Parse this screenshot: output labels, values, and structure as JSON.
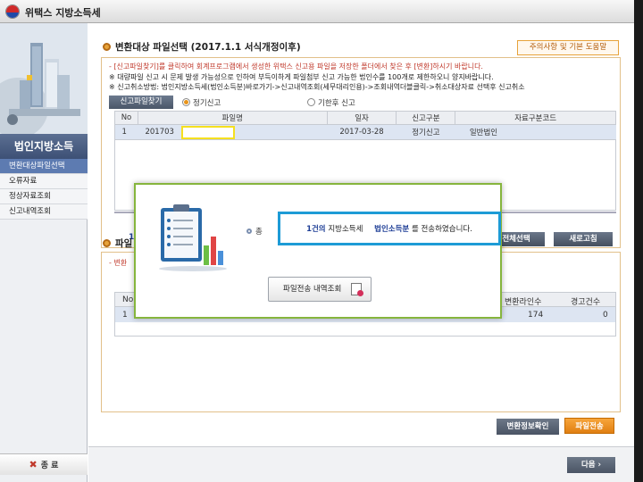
{
  "window": {
    "title": "위택스 지방소득세"
  },
  "sidebar": {
    "title": "법인지방소득",
    "items": [
      {
        "label": "변환대상파일선택",
        "active": true
      },
      {
        "label": "오류자료",
        "active": false
      },
      {
        "label": "정상자료조회",
        "active": false
      },
      {
        "label": "신고내역조회",
        "active": false
      }
    ],
    "exit_label": "종 료"
  },
  "section1": {
    "title": "변환대상 파일선택 (2017.1.1 서식개정이후)",
    "notice_button": "주의사항 및 기본 도움말",
    "info_lines": [
      "- [신고파일찾기]를 클릭하여 회계프로그램에서 생성한 위택스 신고용 파일을 저장한 폴더에서 찾은 후 [변환]하시기 바랍니다.",
      "※ 대량파일 신고 시 문제 발생 가능성으로 인하여 부득이하게 파일첨부 신고 가능한 법인수를 100개로 제한하오니 양지바랍니다.",
      "※ 신고취소방법: 법인지방소득세(법인소득분)바로가기->신고내역조회(세무대리인용)->조회내역더블클릭->취소대상자료 선택후 신고취소"
    ],
    "find_button": "신고파일찾기",
    "radio_regular": "정기신고",
    "radio_late": "기한후 신고",
    "table": {
      "headers": [
        "No",
        "파일명",
        "일자",
        "신고구분",
        "자료구분코드"
      ],
      "rows": [
        {
          "no": "1",
          "file": "201703",
          "date": "2017-03-28",
          "type": "정기신고",
          "code": "일반법인"
        }
      ]
    },
    "partial_number": "1",
    "select_all_button": "전체선택",
    "refresh_button": "새로고침"
  },
  "section2": {
    "title_partial": "파일",
    "info_partial": "- 변환",
    "headers_partial": [
      "No",
      "변환라인수",
      "경고건수"
    ],
    "row": {
      "no": "1",
      "lines": "174",
      "warnings": "0"
    },
    "verify_button": "변환정보확인",
    "send_button": "파일전송"
  },
  "footer": {
    "next_button": "다음 ›"
  },
  "modal": {
    "lead": "총",
    "count": "1건의",
    "tax": "지방소득세",
    "category": "법인소득분",
    "suffix": "를 전송하였습니다.",
    "history_button": "파일전송 내역조회"
  }
}
